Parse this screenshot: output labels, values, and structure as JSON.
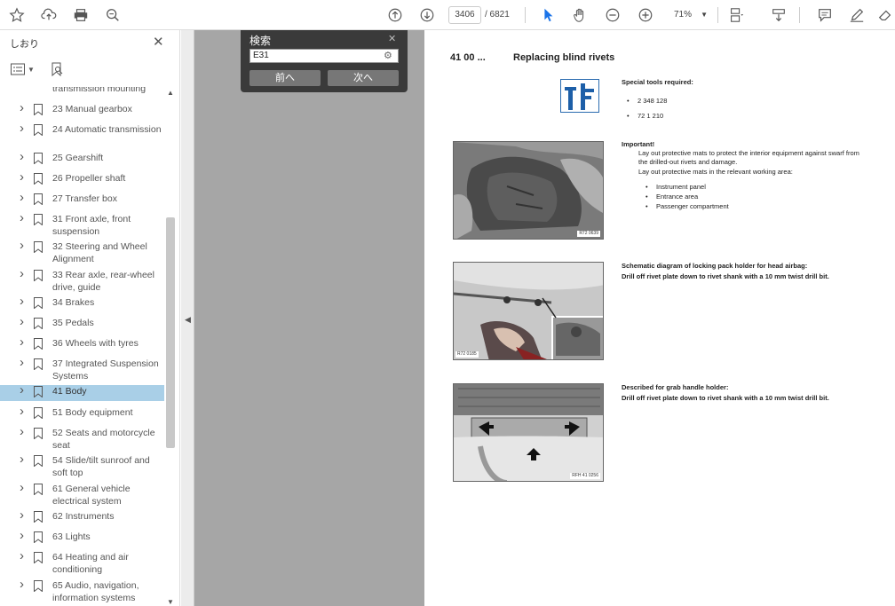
{
  "toolbar": {
    "page_current": "3406",
    "page_total": "/ 6821",
    "zoom": "71%"
  },
  "sidebar": {
    "title": "しおり",
    "items": [
      {
        "label": "transmission mounting",
        "partial": true
      },
      {
        "label": "23 Manual gearbox"
      },
      {
        "label": "24 Automatic transmission"
      },
      {
        "label": "25 Gearshift"
      },
      {
        "label": "26 Propeller shaft"
      },
      {
        "label": "27 Transfer box"
      },
      {
        "label": "31 Front axle, front suspension"
      },
      {
        "label": "32 Steering and Wheel Alignment"
      },
      {
        "label": "33 Rear axle, rear-wheel drive, guide"
      },
      {
        "label": "34 Brakes"
      },
      {
        "label": "35 Pedals"
      },
      {
        "label": "36 Wheels with tyres"
      },
      {
        "label": "37 Integrated Suspension Systems"
      },
      {
        "label": "41 Body",
        "selected": true
      },
      {
        "label": "51 Body equipment"
      },
      {
        "label": "52 Seats and motorcycle seat"
      },
      {
        "label": "54 Slide/tilt sunroof and soft top"
      },
      {
        "label": "61 General vehicle electrical system"
      },
      {
        "label": "62 Instruments"
      },
      {
        "label": "63 Lights"
      },
      {
        "label": "64 Heating and air conditioning"
      },
      {
        "label": "65 Audio, navigation, information systems"
      }
    ]
  },
  "find": {
    "title": "検索",
    "value": "E31",
    "prev_label": "前へ",
    "next_label": "次へ"
  },
  "document": {
    "code": "41 00 ...",
    "title": "Replacing blind rivets",
    "special_tools_heading": "Special tools required:",
    "special_tools": [
      "2 348 128",
      "72 1 210"
    ],
    "important_heading": "Important!",
    "important_text": "Lay out protective mats to protect the interior equipment against swarf from the drilled-out rivets and damage.",
    "important_text2": "Lay out protective mats in the relevant working area:",
    "areas": [
      "Instrument panel",
      "Entrance area",
      "Passenger compartment"
    ],
    "photo1_id": "R72 0639",
    "section2_heading": "Schematic diagram of locking pack holder for head airbag:",
    "section2_text": "Drill off rivet plate down to rivet shank with a 10 mm twist drill bit.",
    "photo2_id": "R72 0185",
    "section3_heading": "Described for grab handle holder:",
    "section3_text": "Drill off rivet plate down to rivet shank with a 10 mm twist drill bit.",
    "photo3_id": "RFH 41 0256"
  }
}
